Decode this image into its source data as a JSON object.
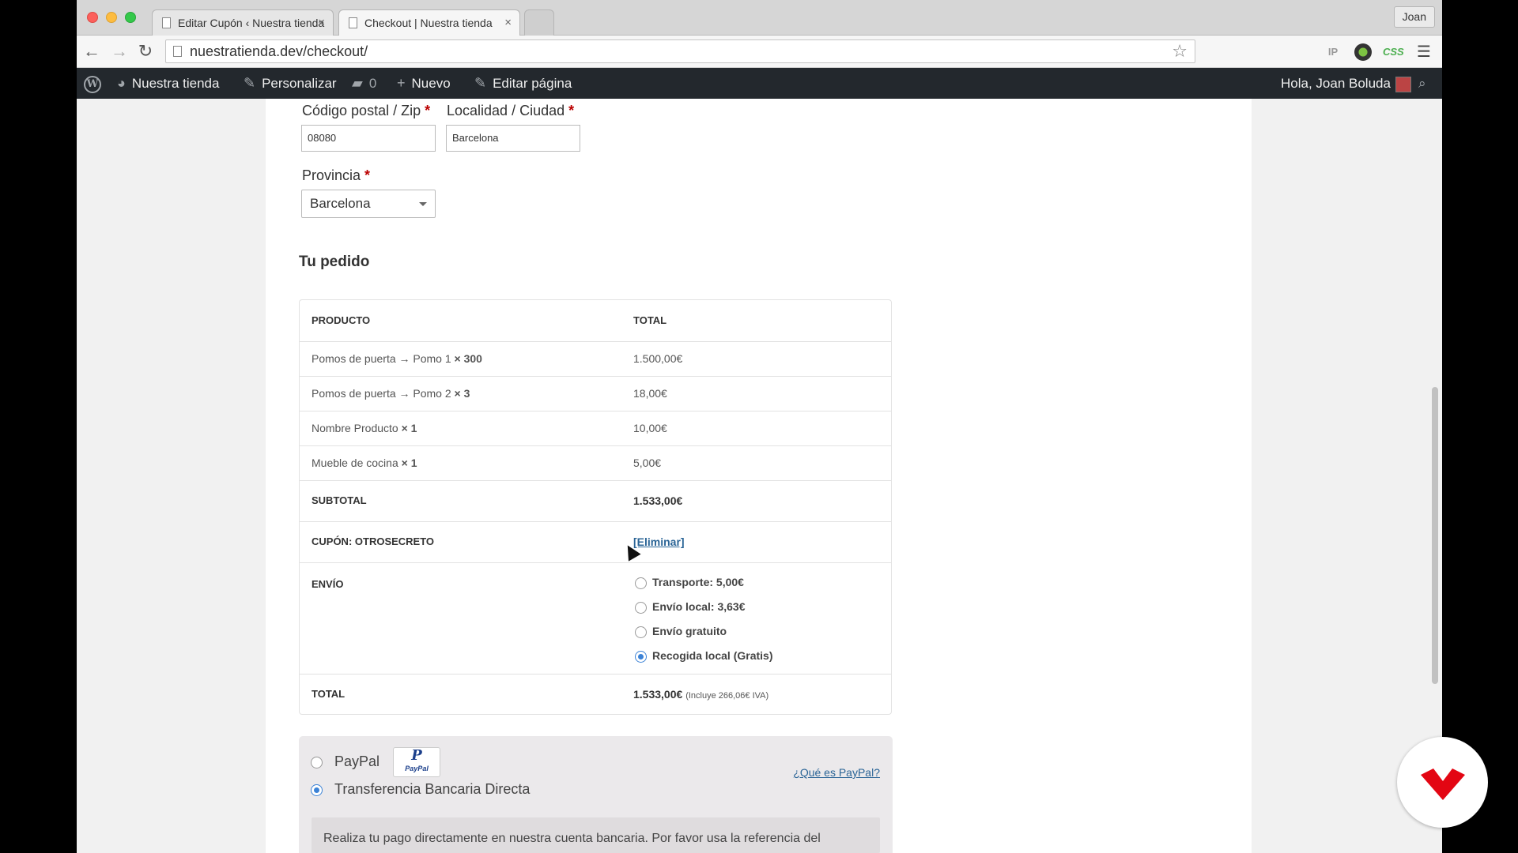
{
  "browser": {
    "tabs": [
      {
        "title": "Editar Cupón ‹ Nuestra tienda",
        "active": false
      },
      {
        "title": "Checkout | Nuestra tienda",
        "active": true
      }
    ],
    "profile": "Joan",
    "url": "nuestratienda.dev/checkout/",
    "extensions": [
      "IP",
      "color-picker-icon",
      "CSS",
      "menu-icon"
    ]
  },
  "adminbar": {
    "site_name": "Nuestra tienda",
    "customize": "Personalizar",
    "comments_count": "0",
    "new": "Nuevo",
    "edit_page": "Editar página",
    "greeting": "Hola, Joan Boluda"
  },
  "form": {
    "postcode_label": "Código postal / Zip",
    "postcode_value": "08080",
    "city_label": "Localidad / Ciudad",
    "city_value": "Barcelona",
    "province_label": "Provincia",
    "province_value": "Barcelona",
    "required_mark": "*"
  },
  "order": {
    "title": "Tu pedido",
    "col_product": "PRODUCTO",
    "col_total": "TOTAL",
    "items": [
      {
        "name": "Pomos de puerta → Pomo 1",
        "qty": "× 300",
        "total": "1.500,00€"
      },
      {
        "name": "Pomos de puerta → Pomo 2",
        "qty": "× 3",
        "total": "18,00€"
      },
      {
        "name": "Nombre Producto",
        "qty": "× 1",
        "total": "10,00€"
      },
      {
        "name": "Mueble de cocina",
        "qty": "× 1",
        "total": "5,00€"
      }
    ],
    "subtotal_label": "SUBTOTAL",
    "subtotal_value": "1.533,00€",
    "coupon_label": "CUPÓN: OTROSECRETO",
    "coupon_remove": "[Eliminar]",
    "shipping_label": "ENVÍO",
    "shipping_options": [
      {
        "label": "Transporte: 5,00€",
        "checked": false
      },
      {
        "label": "Envío local: 3,63€",
        "checked": false
      },
      {
        "label": "Envío gratuito",
        "checked": false
      },
      {
        "label": "Recogida local (Gratis)",
        "checked": true
      }
    ],
    "total_label": "TOTAL",
    "total_value": "1.533,00€",
    "total_tax": "(Incluye 266,06€ IVA)"
  },
  "payment": {
    "paypal_label": "PayPal",
    "paypal_logo_top": "P",
    "paypal_logo_text": "PayPal",
    "paypal_help": "¿Qué es PayPal?",
    "bank_label": "Transferencia Bancaria Directa",
    "bank_description": "Realiza tu pago directamente en nuestra cuenta bancaria. Por favor usa la referencia del"
  },
  "colors": {
    "accent": "#3b82d6",
    "link": "#2a6496",
    "required": "#bb0000",
    "adminbar": "#23282d",
    "brand": "#e30613"
  }
}
